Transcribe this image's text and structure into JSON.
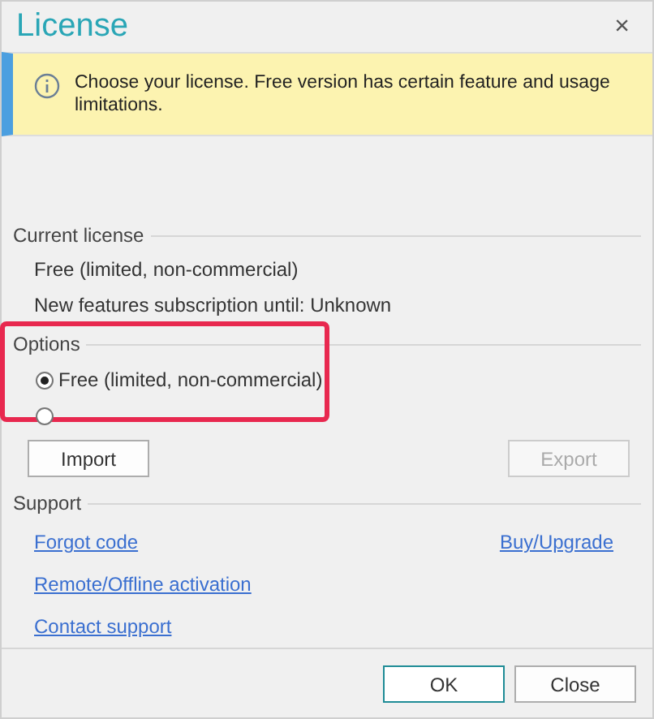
{
  "window": {
    "title": "License",
    "close": "×"
  },
  "banner": {
    "message": "Choose your license. Free version has certain feature and usage limitations."
  },
  "current_license": {
    "heading": "Current license",
    "lines": [
      "Free (limited, non-commercial)",
      "New features subscription until: Unknown"
    ]
  },
  "options": {
    "heading": "Options",
    "highlighted": true,
    "choices": [
      {
        "label": "Free (limited, non-commercial)",
        "selected": true
      },
      {
        "selected": false
      }
    ],
    "buttons": [
      {
        "label": "Import",
        "disabled": false
      },
      {
        "label": "Export",
        "disabled": true
      }
    ]
  },
  "support": {
    "heading": "Support",
    "link_rows": [
      {
        "links": [
          "Forgot code",
          "Buy/Upgrade"
        ]
      },
      {
        "links": [
          "Remote/Offline activation"
        ]
      },
      {
        "links": [
          "Contact support"
        ]
      }
    ]
  },
  "footer_buttons": [
    {
      "label": "OK",
      "default": true
    },
    {
      "label": "Close",
      "default": false
    }
  ]
}
